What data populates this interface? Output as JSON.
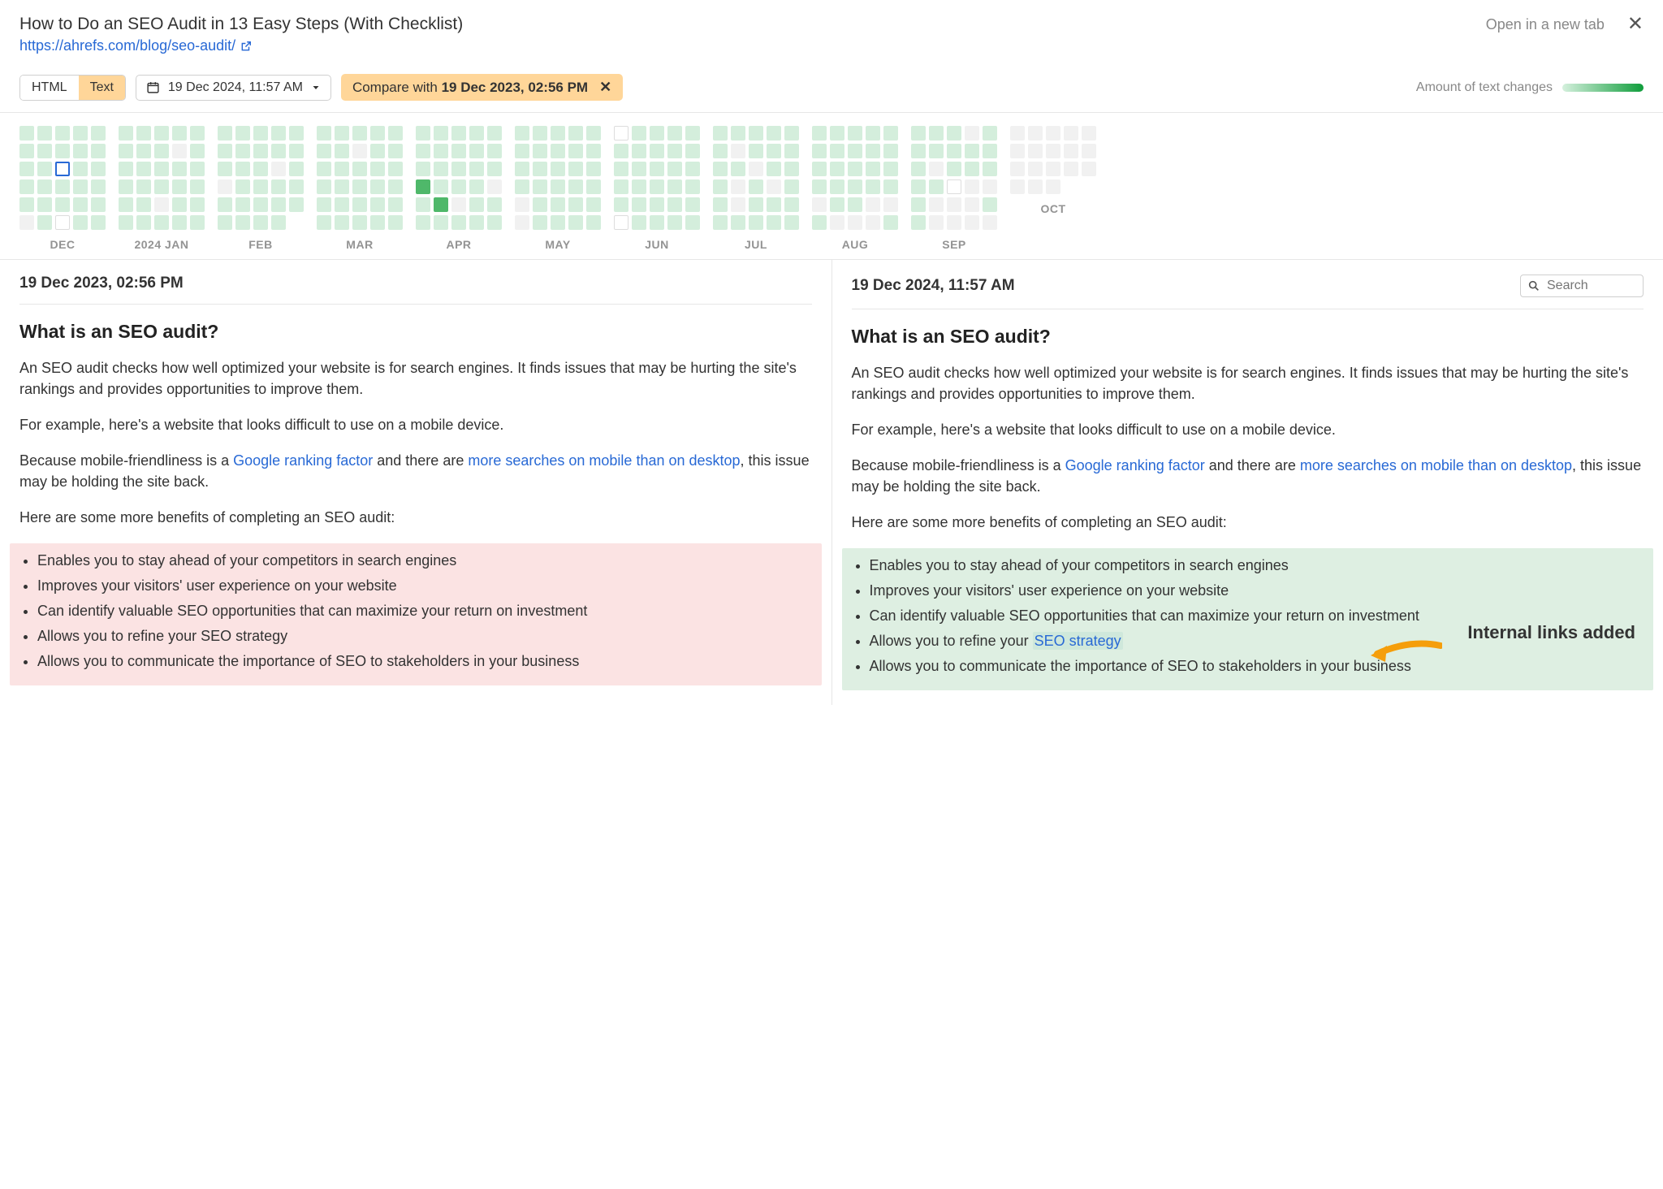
{
  "header": {
    "title": "How to Do an SEO Audit in 13 Easy Steps (With Checklist)",
    "url": "https://ahrefs.com/blog/seo-audit/",
    "open_new_tab": "Open in a new tab"
  },
  "toolbar": {
    "view_html": "HTML",
    "view_text": "Text",
    "date_picker": "19 Dec 2024, 11:57 AM",
    "compare_prefix": "Compare with ",
    "compare_date": "19 Dec 2023, 02:56 PM",
    "legend_label": "Amount of text changes"
  },
  "calendar": {
    "months": [
      "DEC",
      "2024 JAN",
      "FEB",
      "MAR",
      "APR",
      "MAY",
      "JUN",
      "JUL",
      "AUG",
      "SEP",
      "OCT"
    ]
  },
  "panes": {
    "left_date": "19 Dec 2023, 02:56 PM",
    "right_date": "19 Dec 2024, 11:57 AM",
    "search_placeholder": "Search"
  },
  "content": {
    "h2": "What is an SEO audit?",
    "p1": "An SEO audit checks how well optimized your website is for search engines. It finds issues that may be hurting the site's rankings and provides opportunities to improve them.",
    "p2": "For example, here's a website that looks difficult to use on a mobile device.",
    "p3a": "Because mobile-friendliness is a ",
    "p3_link1": "Google ranking factor",
    "p3b": " and there are ",
    "p3_link2": "more searches on mobile than on desktop",
    "p3c": ", this issue may be holding the site back.",
    "p4": "Here are some more benefits of completing an SEO audit:",
    "li1": "Enables you to stay ahead of your competitors in search engines",
    "li2": "Improves your visitors' user experience on your website",
    "li3": "Can identify valuable SEO opportunities that can maximize your return on investment",
    "li4_left": "Allows you to refine your SEO strategy",
    "li4_right_a": "Allows you to refine your ",
    "li4_right_link": "SEO strategy",
    "li5": "Allows you to communicate the importance of SEO to stakeholders in your business"
  },
  "annotation": {
    "text": "Internal links added"
  }
}
